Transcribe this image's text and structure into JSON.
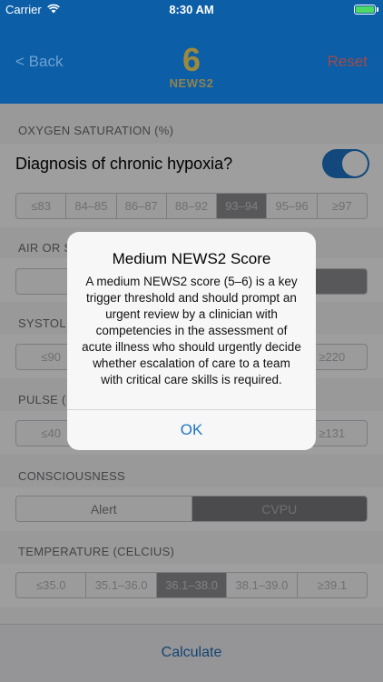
{
  "status_bar": {
    "carrier": "Carrier",
    "time": "8:30 AM"
  },
  "nav": {
    "back_label": "< Back",
    "score": "6",
    "score_label": "NEWS2",
    "reset_label": "Reset"
  },
  "form": {
    "oxygen": {
      "header": "OXYGEN SATURATION (%)",
      "hypoxia_label": "Diagnosis of chronic hypoxia?",
      "hypoxia_on": true,
      "options": [
        "≤83",
        "84–85",
        "86–87",
        "88–92",
        "93–94",
        "95–96",
        "≥97"
      ]
    },
    "air": {
      "header": "AIR OR S"
    },
    "systolic": {
      "header": "SYSTOLI",
      "options_left": "≤90",
      "options_right": "≥220"
    },
    "pulse": {
      "header": "PULSE (",
      "options_left": "≤40",
      "options_right": "≥131"
    },
    "consciousness": {
      "header": "CONSCIOUSNESS",
      "options": [
        "Alert",
        "CVPU"
      ],
      "selected_index": 1
    },
    "temperature": {
      "header": "TEMPERATURE (CELCIUS)",
      "options": [
        "≤35.0",
        "35.1–36.0",
        "36.1–38.0",
        "38.1–39.0",
        "≥39.1"
      ],
      "selected_index": 2
    },
    "calculate_label": "Calculate"
  },
  "alert": {
    "title": "Medium NEWS2 Score",
    "message": "A medium NEWS2 score (5–6) is a key trigger threshold and should prompt an urgent review by a clinician with competencies in the assessment of acute illness who should urgently decide whether escalation of care to a team with critical care skills is required.",
    "ok_label": "OK"
  },
  "colors": {
    "nav_background": "#0c5ea6",
    "score": "#9c8a3c",
    "reset": "#a24a4a",
    "accent": "#1d74c7"
  }
}
